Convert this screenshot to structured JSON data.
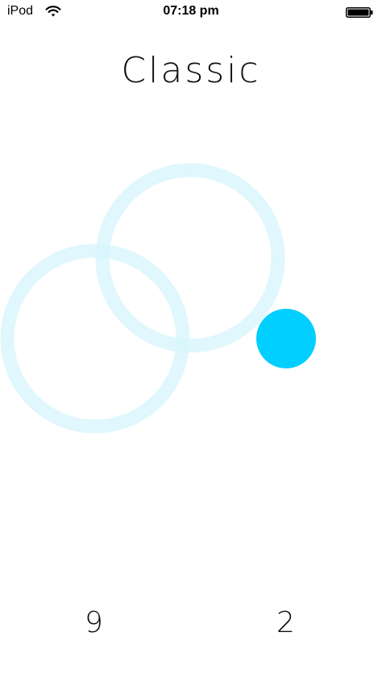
{
  "status_bar": {
    "carrier": "iPod",
    "time": "07:18 pm",
    "wifi_icon": "wifi-icon",
    "battery_icon": "battery-icon",
    "battery_level": 1.0
  },
  "title": "Classic",
  "scores": {
    "left": "9",
    "right": "2"
  },
  "colors": {
    "ring": "#d9f6fd",
    "ball": "#00cfff",
    "text": "#111111"
  }
}
